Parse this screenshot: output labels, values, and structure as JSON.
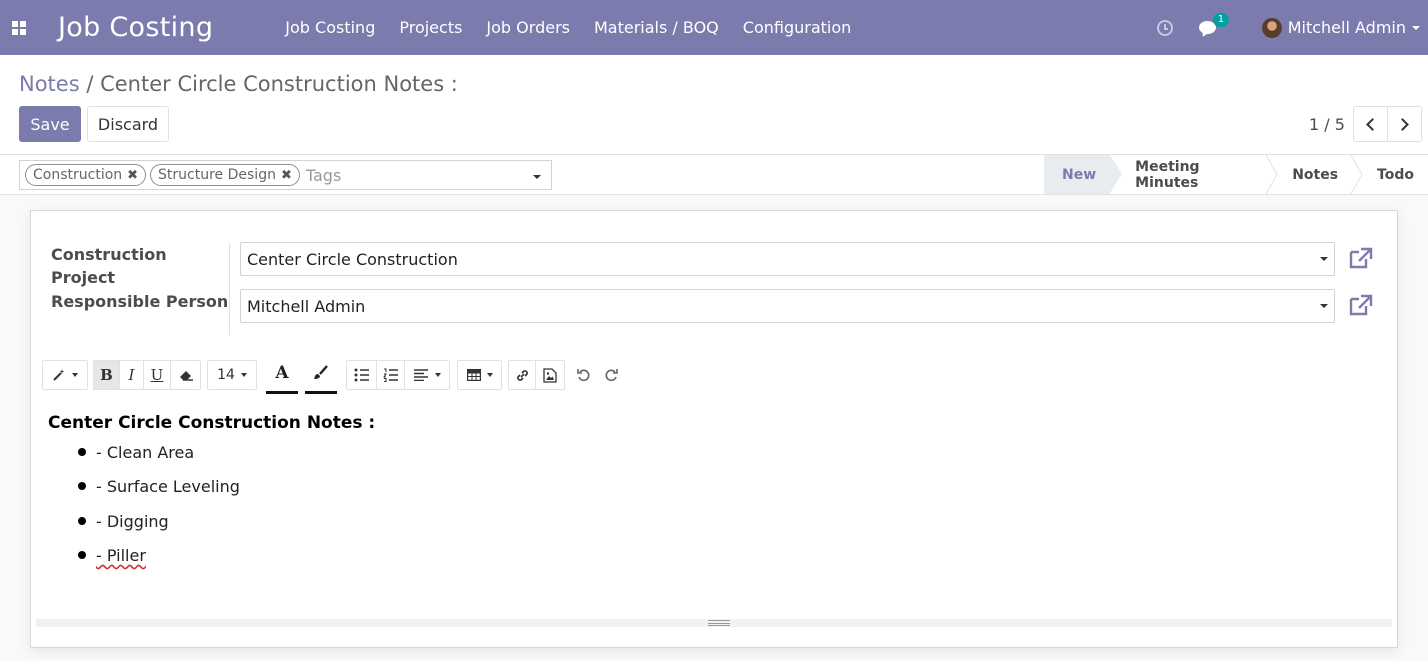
{
  "navbar": {
    "brand": "Job Costing",
    "menu": [
      "Job Costing",
      "Projects",
      "Job Orders",
      "Materials / BOQ",
      "Configuration"
    ],
    "chat_count": "1",
    "user_name": "Mitchell Admin",
    "accent_color": "#7c7bad"
  },
  "breadcrumb": {
    "parent": "Notes",
    "separator": " / ",
    "current": "Center Circle Construction Notes :"
  },
  "actions": {
    "save_label": "Save",
    "discard_label": "Discard"
  },
  "pager": {
    "text": "1 / 5"
  },
  "tags": {
    "items": [
      "Construction",
      "Structure Design"
    ],
    "placeholder": "Tags"
  },
  "stages": {
    "items": [
      "New",
      "Meeting Minutes",
      "Notes",
      "Todo"
    ],
    "active": "New"
  },
  "form": {
    "project_label": "Construction Project",
    "project_value": "Center Circle Construction",
    "responsible_label": "Responsible Person",
    "responsible_value": "Mitchell Admin"
  },
  "toolbar": {
    "font_size": "14",
    "bold_label": "B",
    "italic_label": "I",
    "underline_label": "U",
    "font_color_label": "A"
  },
  "editor": {
    "heading": "Center Circle Construction Notes :",
    "items": [
      "- Clean Area",
      "- Surface Leveling",
      "- Digging",
      "- Piller"
    ]
  }
}
